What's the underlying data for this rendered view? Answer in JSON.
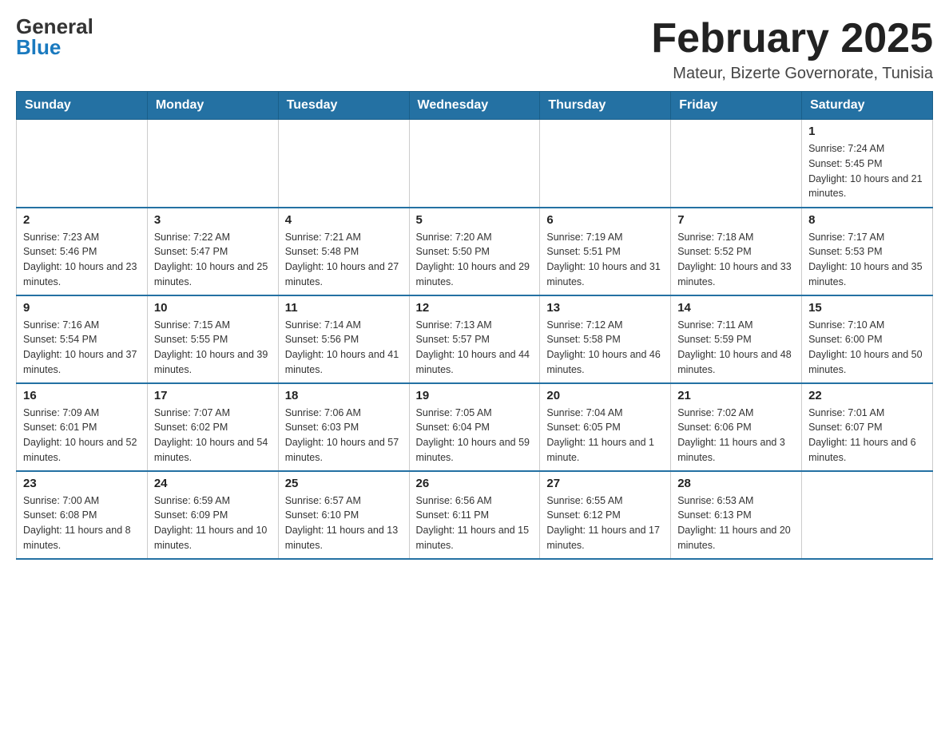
{
  "header": {
    "logo": {
      "general": "General",
      "blue": "Blue",
      "arrow": "▶"
    },
    "title": "February 2025",
    "location": "Mateur, Bizerte Governorate, Tunisia"
  },
  "days_of_week": [
    "Sunday",
    "Monday",
    "Tuesday",
    "Wednesday",
    "Thursday",
    "Friday",
    "Saturday"
  ],
  "weeks": [
    [
      {
        "day": "",
        "info": ""
      },
      {
        "day": "",
        "info": ""
      },
      {
        "day": "",
        "info": ""
      },
      {
        "day": "",
        "info": ""
      },
      {
        "day": "",
        "info": ""
      },
      {
        "day": "",
        "info": ""
      },
      {
        "day": "1",
        "info": "Sunrise: 7:24 AM\nSunset: 5:45 PM\nDaylight: 10 hours and 21 minutes."
      }
    ],
    [
      {
        "day": "2",
        "info": "Sunrise: 7:23 AM\nSunset: 5:46 PM\nDaylight: 10 hours and 23 minutes."
      },
      {
        "day": "3",
        "info": "Sunrise: 7:22 AM\nSunset: 5:47 PM\nDaylight: 10 hours and 25 minutes."
      },
      {
        "day": "4",
        "info": "Sunrise: 7:21 AM\nSunset: 5:48 PM\nDaylight: 10 hours and 27 minutes."
      },
      {
        "day": "5",
        "info": "Sunrise: 7:20 AM\nSunset: 5:50 PM\nDaylight: 10 hours and 29 minutes."
      },
      {
        "day": "6",
        "info": "Sunrise: 7:19 AM\nSunset: 5:51 PM\nDaylight: 10 hours and 31 minutes."
      },
      {
        "day": "7",
        "info": "Sunrise: 7:18 AM\nSunset: 5:52 PM\nDaylight: 10 hours and 33 minutes."
      },
      {
        "day": "8",
        "info": "Sunrise: 7:17 AM\nSunset: 5:53 PM\nDaylight: 10 hours and 35 minutes."
      }
    ],
    [
      {
        "day": "9",
        "info": "Sunrise: 7:16 AM\nSunset: 5:54 PM\nDaylight: 10 hours and 37 minutes."
      },
      {
        "day": "10",
        "info": "Sunrise: 7:15 AM\nSunset: 5:55 PM\nDaylight: 10 hours and 39 minutes."
      },
      {
        "day": "11",
        "info": "Sunrise: 7:14 AM\nSunset: 5:56 PM\nDaylight: 10 hours and 41 minutes."
      },
      {
        "day": "12",
        "info": "Sunrise: 7:13 AM\nSunset: 5:57 PM\nDaylight: 10 hours and 44 minutes."
      },
      {
        "day": "13",
        "info": "Sunrise: 7:12 AM\nSunset: 5:58 PM\nDaylight: 10 hours and 46 minutes."
      },
      {
        "day": "14",
        "info": "Sunrise: 7:11 AM\nSunset: 5:59 PM\nDaylight: 10 hours and 48 minutes."
      },
      {
        "day": "15",
        "info": "Sunrise: 7:10 AM\nSunset: 6:00 PM\nDaylight: 10 hours and 50 minutes."
      }
    ],
    [
      {
        "day": "16",
        "info": "Sunrise: 7:09 AM\nSunset: 6:01 PM\nDaylight: 10 hours and 52 minutes."
      },
      {
        "day": "17",
        "info": "Sunrise: 7:07 AM\nSunset: 6:02 PM\nDaylight: 10 hours and 54 minutes."
      },
      {
        "day": "18",
        "info": "Sunrise: 7:06 AM\nSunset: 6:03 PM\nDaylight: 10 hours and 57 minutes."
      },
      {
        "day": "19",
        "info": "Sunrise: 7:05 AM\nSunset: 6:04 PM\nDaylight: 10 hours and 59 minutes."
      },
      {
        "day": "20",
        "info": "Sunrise: 7:04 AM\nSunset: 6:05 PM\nDaylight: 11 hours and 1 minute."
      },
      {
        "day": "21",
        "info": "Sunrise: 7:02 AM\nSunset: 6:06 PM\nDaylight: 11 hours and 3 minutes."
      },
      {
        "day": "22",
        "info": "Sunrise: 7:01 AM\nSunset: 6:07 PM\nDaylight: 11 hours and 6 minutes."
      }
    ],
    [
      {
        "day": "23",
        "info": "Sunrise: 7:00 AM\nSunset: 6:08 PM\nDaylight: 11 hours and 8 minutes."
      },
      {
        "day": "24",
        "info": "Sunrise: 6:59 AM\nSunset: 6:09 PM\nDaylight: 11 hours and 10 minutes."
      },
      {
        "day": "25",
        "info": "Sunrise: 6:57 AM\nSunset: 6:10 PM\nDaylight: 11 hours and 13 minutes."
      },
      {
        "day": "26",
        "info": "Sunrise: 6:56 AM\nSunset: 6:11 PM\nDaylight: 11 hours and 15 minutes."
      },
      {
        "day": "27",
        "info": "Sunrise: 6:55 AM\nSunset: 6:12 PM\nDaylight: 11 hours and 17 minutes."
      },
      {
        "day": "28",
        "info": "Sunrise: 6:53 AM\nSunset: 6:13 PM\nDaylight: 11 hours and 20 minutes."
      },
      {
        "day": "",
        "info": ""
      }
    ]
  ]
}
